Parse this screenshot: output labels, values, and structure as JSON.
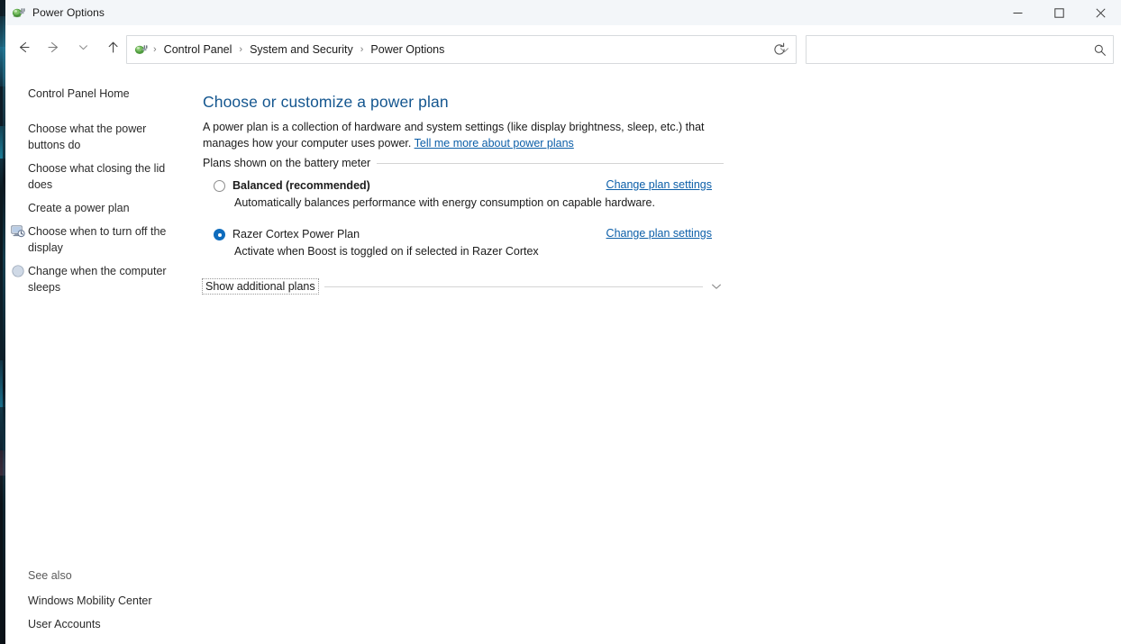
{
  "window": {
    "title": "Power Options",
    "app_icon": "power-plug-icon",
    "controls": {
      "minimize_label": "Minimize",
      "maximize_label": "Maximize",
      "close_label": "Close"
    }
  },
  "toolbar": {
    "back_label": "Back",
    "forward_label": "Forward",
    "recent_label": "Recent locations",
    "up_label": "Up to System and Security",
    "refresh_label": "Refresh",
    "address_icon": "power-plug-icon",
    "address_dropdown_label": "Previous locations",
    "breadcrumbs": [
      {
        "label": "Control Panel"
      },
      {
        "label": "System and Security"
      },
      {
        "label": "Power Options"
      }
    ],
    "separator": "›"
  },
  "search": {
    "value": "",
    "placeholder": "",
    "icon": "search-icon"
  },
  "help": {
    "label": "?",
    "name": "help-button",
    "color": "#1f7fd0"
  },
  "sidebar": {
    "home_label": "Control Panel Home",
    "items": [
      {
        "label": "Choose what the power buttons do",
        "icon": null
      },
      {
        "label": "Choose what closing the lid does",
        "icon": null
      },
      {
        "label": "Create a power plan",
        "icon": null
      },
      {
        "label": "Choose when to turn off the display",
        "icon": "monitor-clock-icon"
      },
      {
        "label": "Change when the computer sleeps",
        "icon": "moon-sleep-icon"
      }
    ],
    "see_also": {
      "title": "See also",
      "links": [
        {
          "label": "Windows Mobility Center"
        },
        {
          "label": "User Accounts"
        }
      ]
    }
  },
  "main": {
    "heading": "Choose or customize a power plan",
    "description_part1": "A power plan is a collection of hardware and system settings (like display brightness, sleep, etc.) that manages how your computer uses power. ",
    "description_link": "Tell me more about power plans",
    "group_header": "Plans shown on the battery meter",
    "plans": [
      {
        "name": "Balanced (recommended)",
        "description": "Automatically balances performance with energy consumption on capable hardware.",
        "selected": false,
        "bold": true,
        "change_link": "Change plan settings"
      },
      {
        "name": "Razer Cortex Power Plan",
        "description": "Activate when Boost is toggled on if selected in Razer Cortex",
        "selected": true,
        "bold": false,
        "change_link": "Change plan settings"
      }
    ],
    "show_additional": {
      "label": "Show additional plans",
      "expander_icon": "chevron-down-icon"
    }
  },
  "colors": {
    "accent_link": "#0b5ea8",
    "heading": "#14568f",
    "radio_selected": "#0f6cbd",
    "titlebar_bg": "#f3f6f9",
    "content_bg": "#ffffff",
    "rule": "#d4d4d4"
  }
}
